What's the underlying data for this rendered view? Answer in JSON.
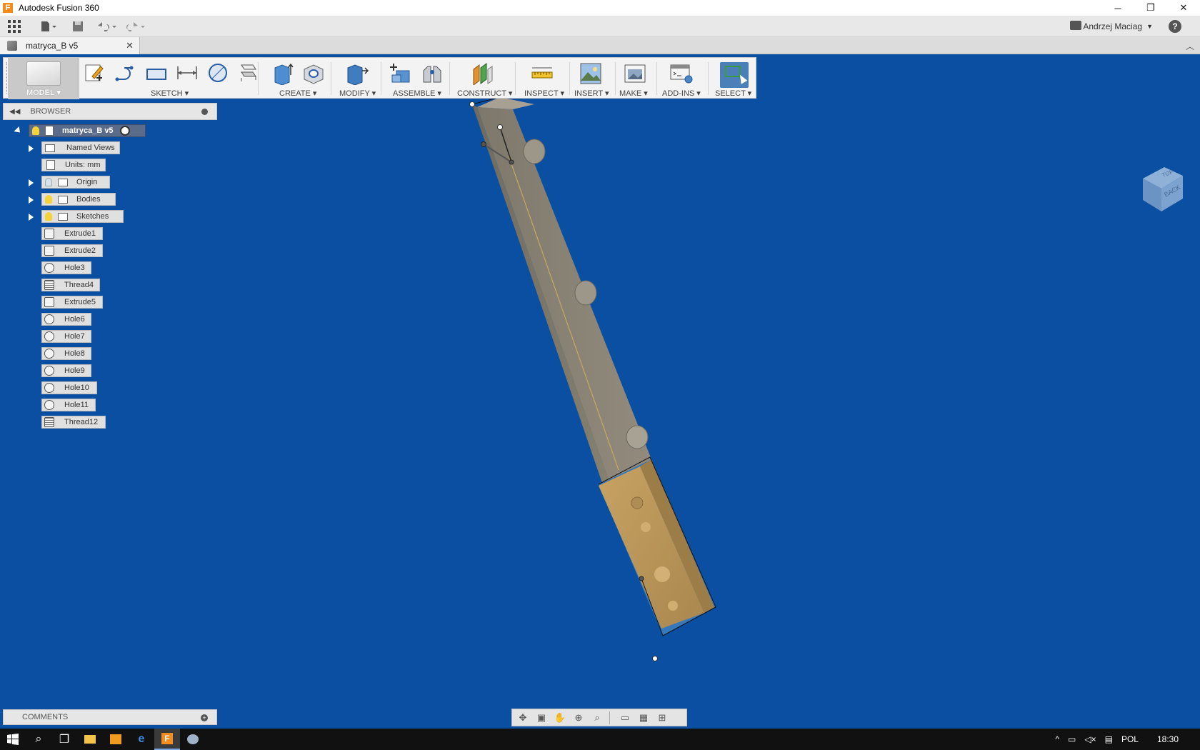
{
  "window": {
    "title": "Autodesk Fusion 360",
    "minimize": "─",
    "restore": "❐",
    "close": "✕"
  },
  "quick_access": {
    "user": "Andrzej Maciag",
    "help": "?"
  },
  "document_tab": {
    "label": "matryca_B v5",
    "close": "✕"
  },
  "ribbon": {
    "workspace": "MODEL",
    "groups": [
      "SKETCH",
      "CREATE",
      "MODIFY",
      "ASSEMBLE",
      "CONSTRUCT",
      "INSPECT",
      "INSERT",
      "MAKE",
      "ADD-INS",
      "SELECT"
    ]
  },
  "browser": {
    "title": "BROWSER",
    "root": "matryca_B v5",
    "items": [
      {
        "label": "Named Views"
      },
      {
        "label": "Units: mm"
      },
      {
        "label": "Origin"
      },
      {
        "label": "Bodies"
      },
      {
        "label": "Sketches"
      }
    ],
    "features": [
      "Extrude1",
      "Extrude2",
      "Hole3",
      "Thread4",
      "Extrude5",
      "Hole6",
      "Hole7",
      "Hole8",
      "Hole9",
      "Hole10",
      "Hole11",
      "Thread12"
    ]
  },
  "viewcube": {
    "face_back": "BACK",
    "face_top": "TOP"
  },
  "comments": {
    "title": "COMMENTS"
  },
  "taskbar": {
    "language": "POL",
    "time": "18:30"
  },
  "colors": {
    "viewport_bg": "#0a4fa1",
    "part_grey": "#8a8375",
    "part_tan": "#b8965a",
    "highlight_blue": "#3f7fbf"
  }
}
